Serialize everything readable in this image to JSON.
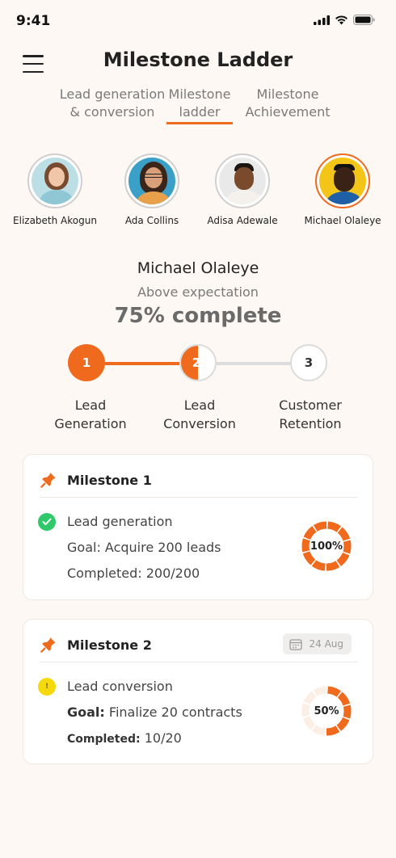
{
  "status_bar": {
    "time": "9:41",
    "signal_icon": "cellular-signal-icon",
    "wifi_icon": "wifi-icon",
    "battery_icon": "battery-icon"
  },
  "header": {
    "title": "Milestone Ladder",
    "menu_icon": "hamburger-menu-icon"
  },
  "tabs": [
    {
      "label": "Lead generation\n& conversion",
      "active": false
    },
    {
      "label": "Milestone\nladder",
      "active": true
    },
    {
      "label": "Milestone\nAchievement",
      "active": false
    }
  ],
  "team": [
    {
      "name": "Elizabeth Akogun",
      "selected": false
    },
    {
      "name": "Ada Collins",
      "selected": false
    },
    {
      "name": "Adisa Adewale",
      "selected": false
    },
    {
      "name": "Michael Olaleye",
      "selected": true
    }
  ],
  "selected": {
    "name": "Michael Olaleye",
    "status": "Above expectation",
    "progress": "75% complete"
  },
  "ladder": {
    "steps": [
      {
        "number": "1",
        "label": "Lead\nGeneration",
        "fill": 1.0
      },
      {
        "number": "2",
        "label": "Lead\nConversion",
        "fill": 0.5
      },
      {
        "number": "3",
        "label": "Customer\nRetention",
        "fill": 0.0
      }
    ]
  },
  "milestones": [
    {
      "title": "Milestone 1",
      "pin_icon": "pushpin-icon",
      "status_icon": "check-circle-icon",
      "task": "Lead generation",
      "goal_label": "Goal:",
      "goal_value": "Acquire 200 leads",
      "completed_label": "Completed:",
      "completed_value": "200/200",
      "percent_text": "100%",
      "percent": 1.0
    },
    {
      "title": "Milestone 2",
      "pin_icon": "pushpin-icon",
      "status_icon": "in-progress-dot-icon",
      "date_icon": "calendar-icon",
      "date": "24 Aug",
      "task": "Lead conversion",
      "goal_label": "Goal:",
      "goal_value": "Finalize 20 contracts",
      "completed_label": "Completed:",
      "completed_value": "10/20",
      "percent_text": "50%",
      "percent": 0.5
    }
  ],
  "colors": {
    "accent": "#f06a1e",
    "success": "#2fc96a",
    "warning": "#f5d90a",
    "track": "#dcdcdc",
    "background": "#fdf8f4"
  }
}
